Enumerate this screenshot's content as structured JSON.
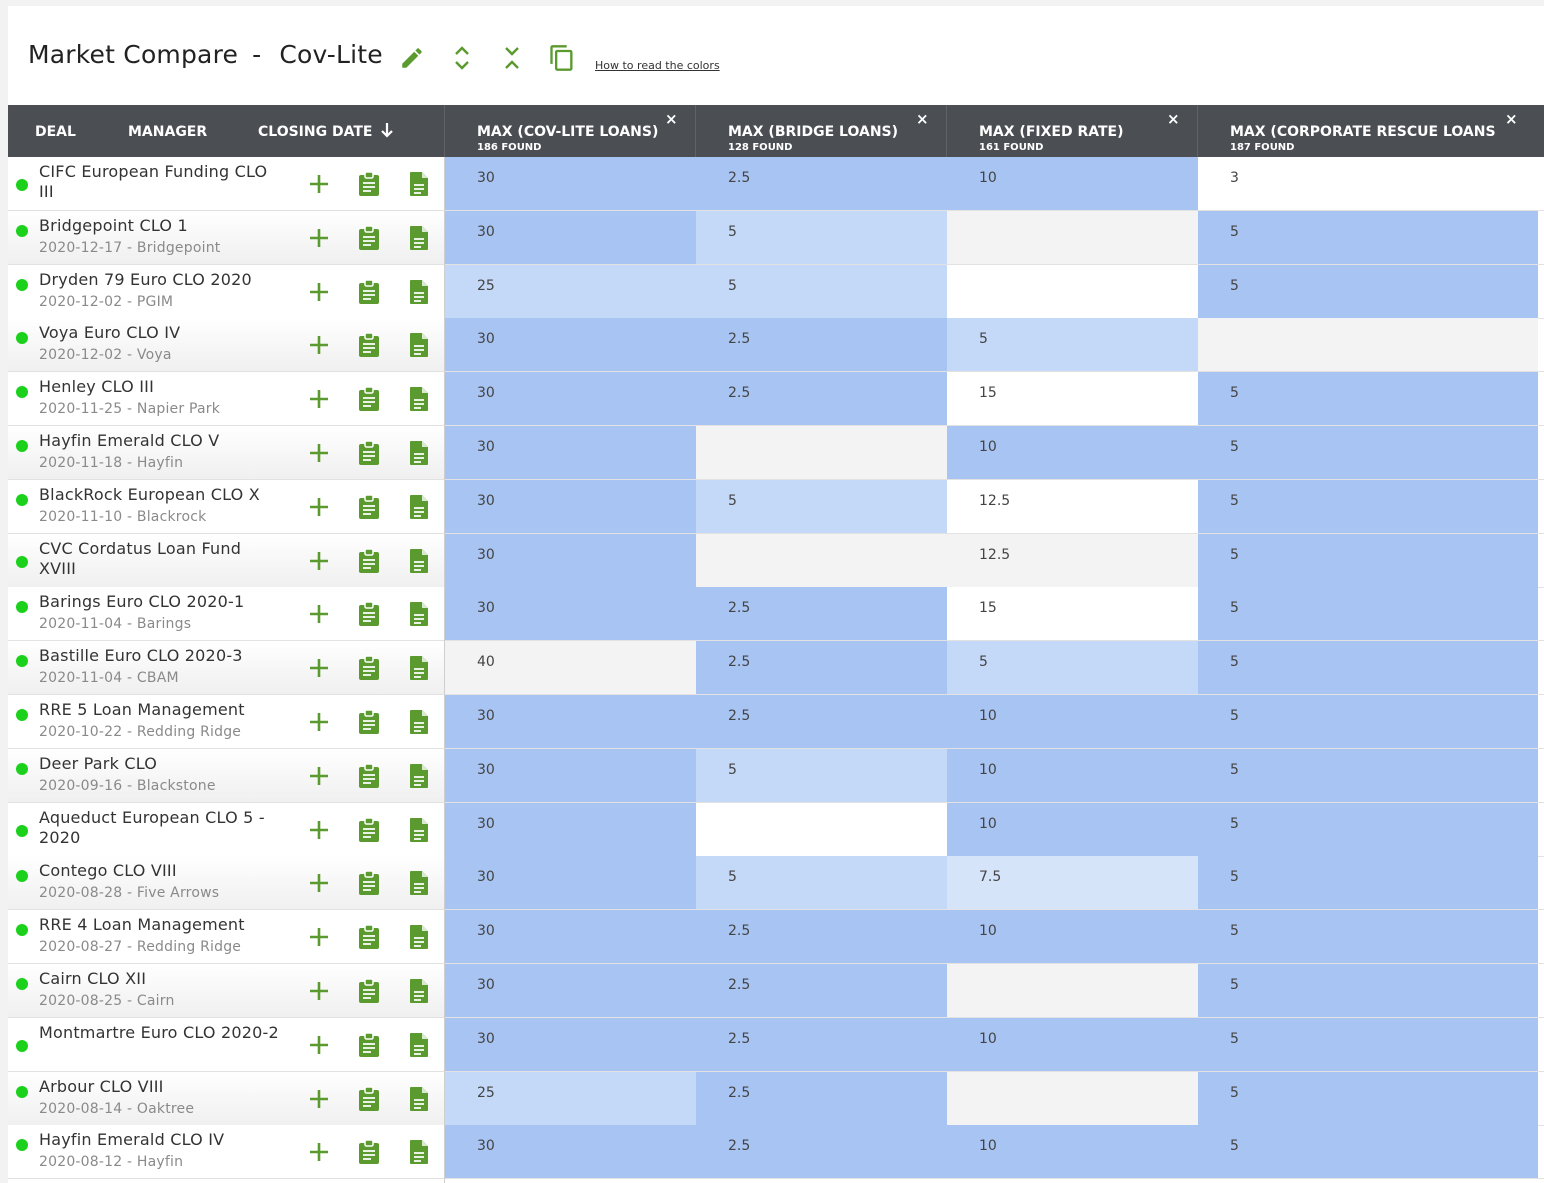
{
  "header": {
    "title": "Market Compare",
    "separator": "-",
    "subtitle": "Cov-Lite",
    "how_to_link": "How to read the colors",
    "icons": [
      "pencil-icon",
      "expand-icon",
      "collapse-icon",
      "copy-icon"
    ]
  },
  "columns": {
    "deal": "DEAL",
    "manager": "MANAGER",
    "closing_date": "CLOSING DATE",
    "metrics": [
      {
        "label": "MAX (COV-LITE LOANS)",
        "found": "186 FOUND",
        "close": "×"
      },
      {
        "label": "MAX (BRIDGE LOANS)",
        "found": "128 FOUND",
        "close": "×"
      },
      {
        "label": "MAX (FIXED RATE)",
        "found": "161 FOUND",
        "close": "×"
      },
      {
        "label": "MAX (CORPORATE RESCUE LOANS",
        "found": "187 FOUND",
        "close": "×"
      }
    ]
  },
  "colors": {
    "status": "#1bd11b",
    "action_icon": "#5a9a2e",
    "header_bg": "#4b4f54",
    "shade_dark": "#a8c4f2",
    "shade_light": "#c4d8f8",
    "shade_lighter": "#d6e4fa",
    "shade_none": "#ffffff",
    "shade_grey": "#f3f3f3"
  },
  "rows": [
    {
      "name": "CIFC European Funding CLO III",
      "sub": "",
      "values": [
        "30",
        "2.5",
        "10",
        "3"
      ],
      "shades": [
        "dark",
        "dark",
        "dark",
        "none"
      ]
    },
    {
      "name": "Bridgepoint CLO 1",
      "sub": "2020-12-17 - Bridgepoint",
      "values": [
        "30",
        "5",
        "",
        "5"
      ],
      "shades": [
        "dark",
        "light",
        "grey",
        "dark"
      ]
    },
    {
      "name": "Dryden 79 Euro CLO 2020",
      "sub": "2020-12-02 - PGIM",
      "values": [
        "25",
        "5",
        "",
        "5"
      ],
      "shades": [
        "light",
        "light",
        "none",
        "dark"
      ]
    },
    {
      "name": "Voya Euro CLO IV",
      "sub": "2020-12-02 - Voya",
      "values": [
        "30",
        "2.5",
        "5",
        ""
      ],
      "shades": [
        "dark",
        "dark",
        "light",
        "grey"
      ]
    },
    {
      "name": "Henley CLO III",
      "sub": "2020-11-25 - Napier Park",
      "values": [
        "30",
        "2.5",
        "15",
        "5"
      ],
      "shades": [
        "dark",
        "dark",
        "none",
        "dark"
      ]
    },
    {
      "name": "Hayfin Emerald CLO V",
      "sub": "2020-11-18 - Hayfin",
      "values": [
        "30",
        "",
        "10",
        "5"
      ],
      "shades": [
        "dark",
        "grey",
        "dark",
        "dark"
      ]
    },
    {
      "name": "BlackRock European CLO X",
      "sub": "2020-11-10 - Blackrock",
      "values": [
        "30",
        "5",
        "12.5",
        "5"
      ],
      "shades": [
        "dark",
        "light",
        "none",
        "dark"
      ]
    },
    {
      "name": "CVC Cordatus Loan Fund XVIII",
      "sub": "",
      "values": [
        "30",
        "",
        "12.5",
        "5"
      ],
      "shades": [
        "dark",
        "grey",
        "grey",
        "dark"
      ]
    },
    {
      "name": "Barings Euro CLO 2020-1",
      "sub": "2020-11-04 - Barings",
      "values": [
        "30",
        "2.5",
        "15",
        "5"
      ],
      "shades": [
        "dark",
        "dark",
        "none",
        "dark"
      ]
    },
    {
      "name": "Bastille Euro CLO 2020-3",
      "sub": "2020-11-04 - CBAM",
      "values": [
        "40",
        "2.5",
        "5",
        "5"
      ],
      "shades": [
        "grey",
        "dark",
        "light",
        "dark"
      ]
    },
    {
      "name": "RRE 5 Loan Management",
      "sub": "2020-10-22 - Redding Ridge",
      "values": [
        "30",
        "2.5",
        "10",
        "5"
      ],
      "shades": [
        "dark",
        "dark",
        "dark",
        "dark"
      ]
    },
    {
      "name": "Deer Park CLO",
      "sub": "2020-09-16 - Blackstone",
      "values": [
        "30",
        "5",
        "10",
        "5"
      ],
      "shades": [
        "dark",
        "light",
        "dark",
        "dark"
      ]
    },
    {
      "name": "Aqueduct European CLO 5 - 2020",
      "sub": "",
      "values": [
        "30",
        "",
        "10",
        "5"
      ],
      "shades": [
        "dark",
        "none",
        "dark",
        "dark"
      ]
    },
    {
      "name": "Contego CLO VIII",
      "sub": "2020-08-28 - Five Arrows",
      "values": [
        "30",
        "5",
        "7.5",
        "5"
      ],
      "shades": [
        "dark",
        "light",
        "lighter",
        "dark"
      ]
    },
    {
      "name": "RRE 4 Loan Management",
      "sub": "2020-08-27 - Redding Ridge",
      "values": [
        "30",
        "2.5",
        "10",
        "5"
      ],
      "shades": [
        "dark",
        "dark",
        "dark",
        "dark"
      ]
    },
    {
      "name": "Cairn CLO XII",
      "sub": "2020-08-25 - Cairn",
      "values": [
        "30",
        "2.5",
        "",
        "5"
      ],
      "shades": [
        "dark",
        "dark",
        "grey",
        "dark"
      ]
    },
    {
      "name": "Montmartre Euro CLO 2020-2",
      "sub": "",
      "values": [
        "30",
        "2.5",
        "10",
        "5"
      ],
      "shades": [
        "dark",
        "dark",
        "dark",
        "dark"
      ]
    },
    {
      "name": "Arbour CLO VIII",
      "sub": "2020-08-14 - Oaktree",
      "values": [
        "25",
        "2.5",
        "",
        "5"
      ],
      "shades": [
        "light",
        "dark",
        "grey",
        "dark"
      ]
    },
    {
      "name": "Hayfin Emerald CLO IV",
      "sub": "2020-08-12 - Hayfin",
      "values": [
        "30",
        "2.5",
        "10",
        "5"
      ],
      "shades": [
        "dark",
        "dark",
        "dark",
        "dark"
      ]
    }
  ]
}
